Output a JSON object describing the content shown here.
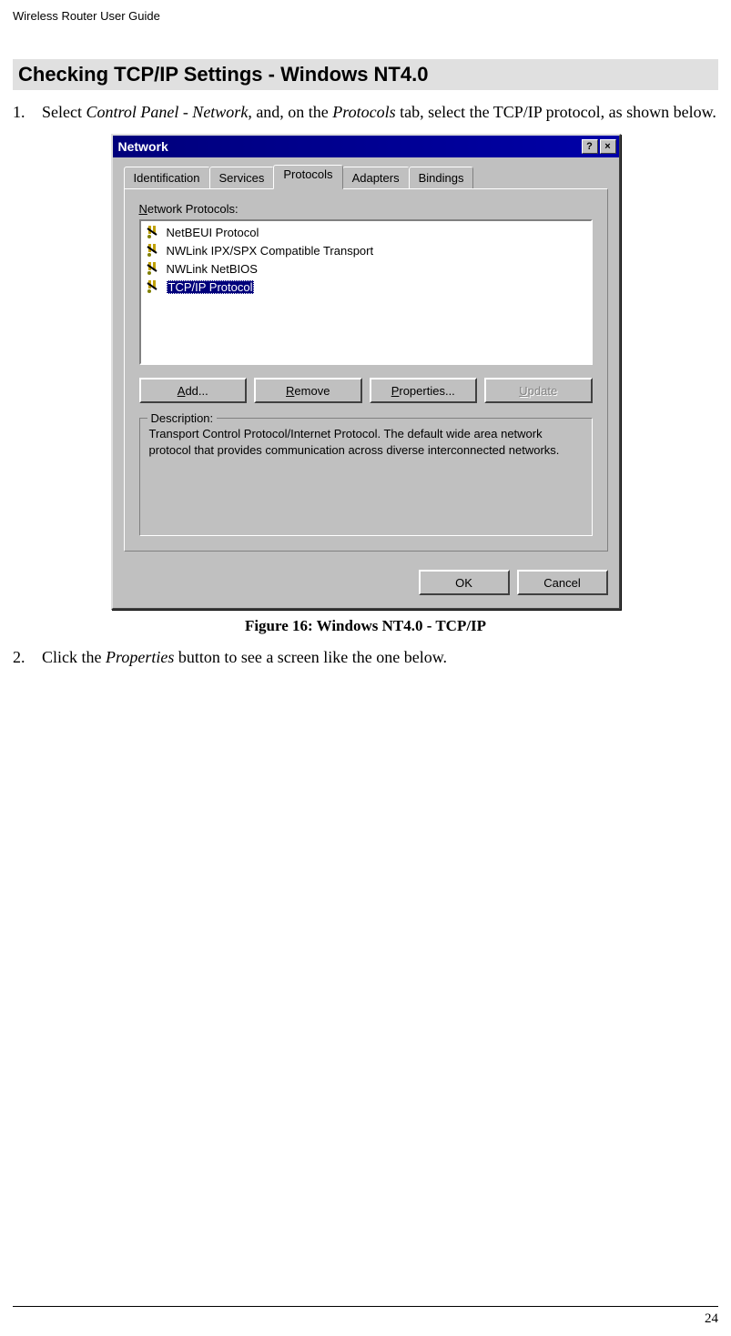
{
  "doc_header": "Wireless Router User Guide",
  "section_heading": "Checking TCP/IP Settings - Windows NT4.0",
  "step1": {
    "pre": "Select ",
    "i1": "Control Panel - Network",
    "mid": ", and, on the ",
    "i2": "Protocols",
    "post": " tab, select the TCP/IP protocol, as shown below."
  },
  "dialog": {
    "title": "Network",
    "help_glyph": "?",
    "close_glyph": "×",
    "tabs": {
      "identification": "Identification",
      "services": "Services",
      "protocols": "Protocols",
      "adapters": "Adapters",
      "bindings": "Bindings"
    },
    "np_label_pre": "N",
    "np_label_post": "etwork Protocols:",
    "protocols": {
      "netbeui": "NetBEUI Protocol",
      "nwlink_ipx": "NWLink IPX/SPX Compatible Transport",
      "nwlink_nb": "NWLink NetBIOS",
      "tcpip": "TCP/IP Protocol"
    },
    "buttons": {
      "add_u": "A",
      "add_rest": "dd...",
      "remove_u": "R",
      "remove_rest": "emove",
      "props_u": "P",
      "props_rest": "roperties...",
      "update_u": "U",
      "update_rest": "pdate"
    },
    "desc_label": "Description:",
    "desc_text": "Transport Control Protocol/Internet Protocol. The default wide area network protocol that provides communication across diverse interconnected networks.",
    "ok": "OK",
    "cancel": "Cancel"
  },
  "figure_caption": "Figure 16: Windows NT4.0 - TCP/IP",
  "step2": {
    "pre": "Click the ",
    "i1": "Properties",
    "post": " button to see a screen like the one below."
  },
  "page_number": "24"
}
